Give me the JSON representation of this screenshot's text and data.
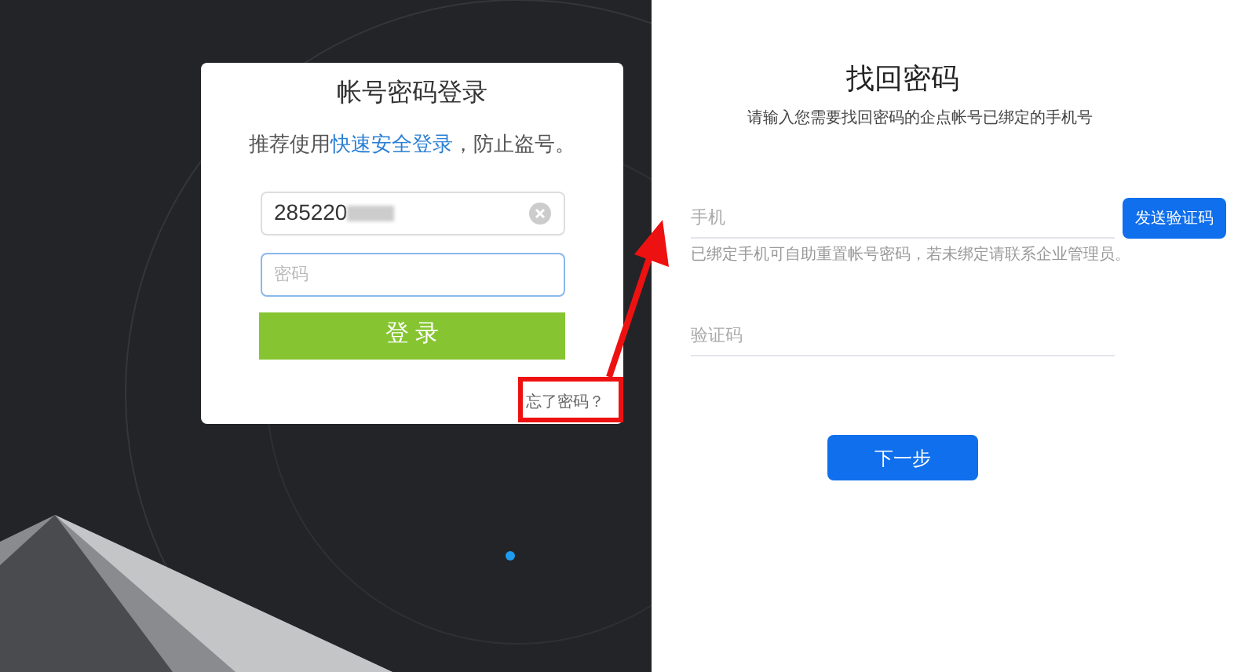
{
  "login_card": {
    "title": "帐号密码登录",
    "subtitle_before": "推荐使用",
    "subtitle_link": "快速安全登录",
    "subtitle_after": "，防止盗号。",
    "username": {
      "value": "285220"
    },
    "password": {
      "placeholder": "密码",
      "focused": true
    },
    "login_button": "登 录",
    "forgot_link": "忘了密码？"
  },
  "recover": {
    "title": "找回密码",
    "subtitle": "请输入您需要找回密码的企点帐号已绑定的手机号",
    "phone": {
      "placeholder": "手机"
    },
    "send_button": "发送验证码",
    "phone_hint": "已绑定手机可自助重置帐号密码，若未绑定请联系企业管理员。",
    "code": {
      "placeholder": "验证码"
    },
    "next_button": "下一步"
  }
}
